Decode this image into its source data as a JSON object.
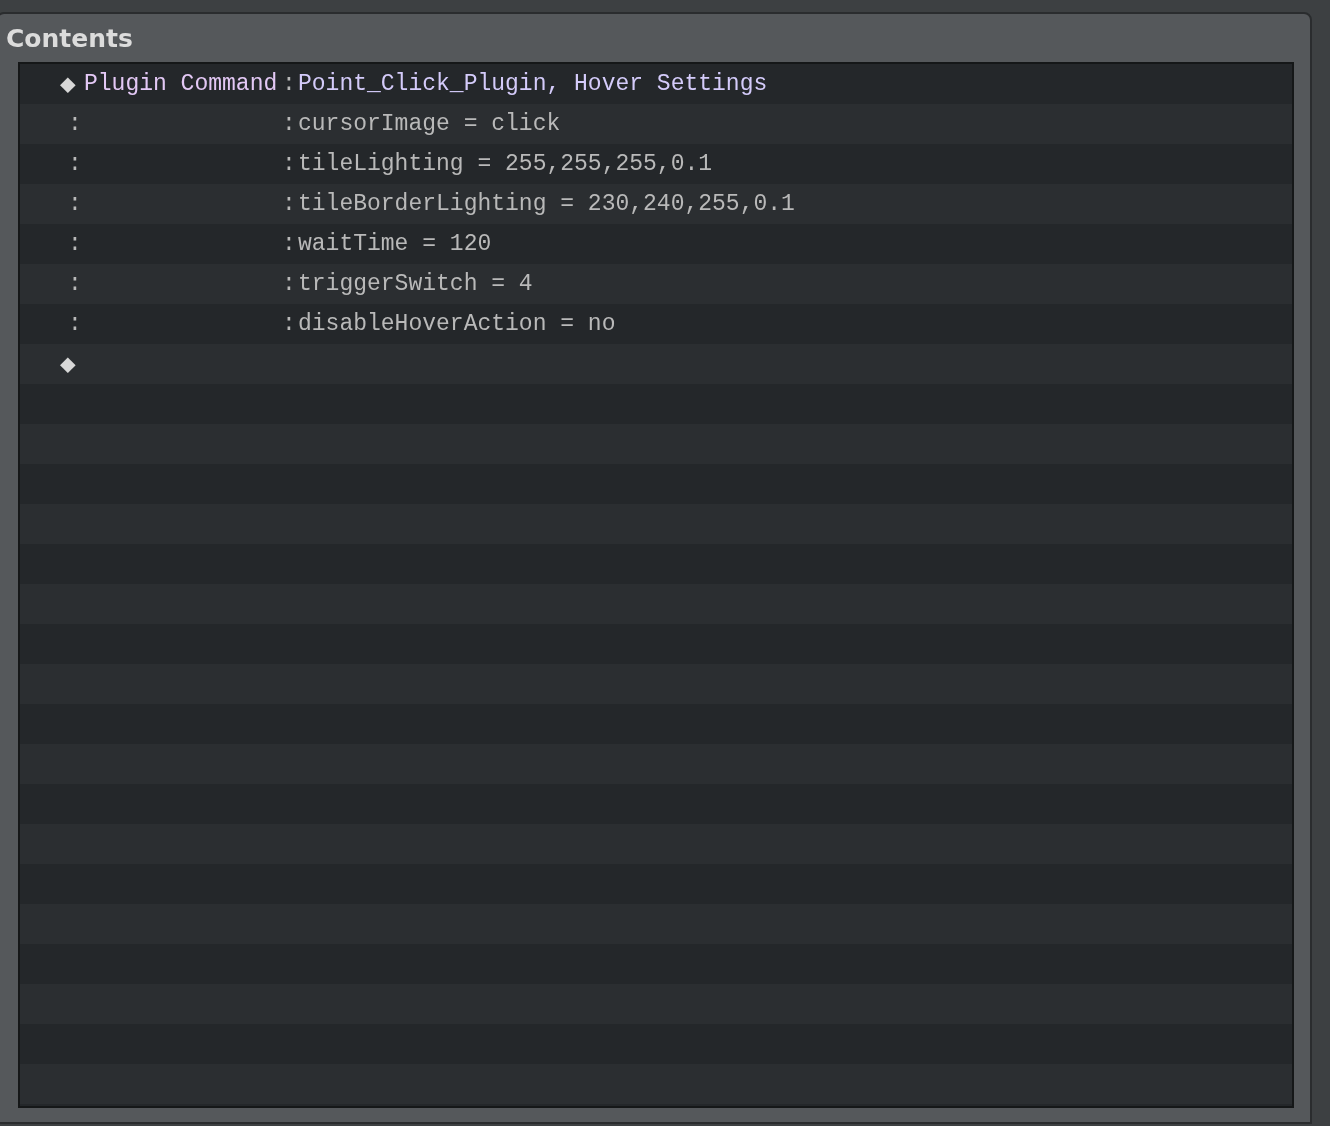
{
  "panel": {
    "title": "Contents"
  },
  "commands": [
    {
      "kind": "command",
      "marker": "◆",
      "label": "Plugin Command",
      "separator": ":",
      "value": "Point_Click_Plugin, Hover Settings"
    },
    {
      "kind": "param",
      "marker": ":",
      "separator": ":",
      "value": "cursorImage = click"
    },
    {
      "kind": "param",
      "marker": ":",
      "separator": ":",
      "value": "tileLighting = 255,255,255,0.1"
    },
    {
      "kind": "param",
      "marker": ":",
      "separator": ":",
      "value": "tileBorderLighting = 230,240,255,0.1"
    },
    {
      "kind": "param",
      "marker": ":",
      "separator": ":",
      "value": "waitTime = 120"
    },
    {
      "kind": "param",
      "marker": ":",
      "separator": ":",
      "value": "triggerSwitch = 4"
    },
    {
      "kind": "param",
      "marker": ":",
      "separator": ":",
      "value": "disableHoverAction = no"
    },
    {
      "kind": "end",
      "marker": "◆"
    }
  ]
}
